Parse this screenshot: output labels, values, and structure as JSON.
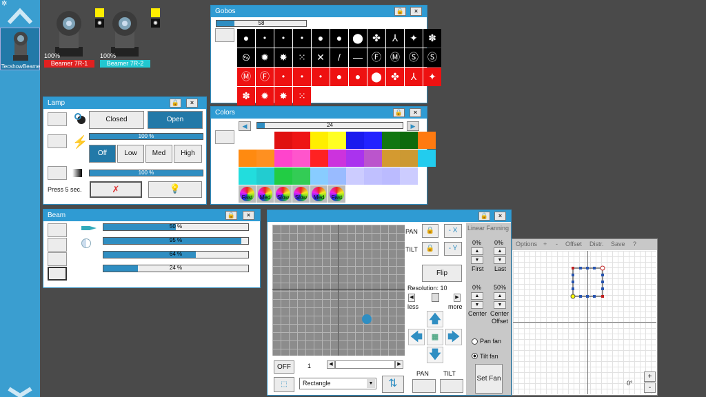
{
  "sidebar": {
    "fixture_label": "TecshowBeame"
  },
  "fixtures": [
    {
      "name": "Beamer 7R-1",
      "intensity": "100%",
      "color": "#e02020"
    },
    {
      "name": "Beamer 7R-2",
      "intensity": "100%",
      "color": "#22c7d0"
    }
  ],
  "gobos": {
    "title": "Gobos",
    "value": "58",
    "level": 0.2
  },
  "lamp": {
    "title": "Lamp",
    "closed": "Closed",
    "open": "Open",
    "lamp_level": "100 %",
    "dimmer_level": "100 %",
    "off": "Off",
    "low": "Low",
    "med": "Med",
    "high": "High",
    "press": "Press 5 sec."
  },
  "colors": {
    "title": "Colors",
    "value": "24",
    "level": 0.05,
    "speeds": [
      "Fast",
      "Med",
      "Slow",
      "Slow",
      "Med",
      "Fast"
    ]
  },
  "beam": {
    "title": "Beam",
    "bars": [
      {
        "label": "50 %",
        "level": 0.5
      },
      {
        "label": "95 %",
        "level": 0.95
      },
      {
        "label": "64 %",
        "level": 0.64
      },
      {
        "label": "24 %",
        "level": 0.24
      }
    ]
  },
  "pantilt": {
    "pan": "PAN",
    "tilt": "TILT",
    "neg_x": "- X",
    "neg_y": "- Y",
    "flip": "Flip",
    "resolution": "Resolution: 10",
    "less": "less",
    "more": "more",
    "off": "OFF",
    "step": "1",
    "shape": "Rectangle",
    "pan_bottom": "PAN",
    "tilt_bottom": "TILT"
  },
  "fanning": {
    "title": "Linear Fanning",
    "first_val": "0%",
    "last_val": "0%",
    "first": "First",
    "last": "Last",
    "center_val": "0%",
    "offset_val": "50%",
    "center": "Center",
    "center_offset1": "Center",
    "center_offset2": "Offset",
    "pan_fan": "Pan fan",
    "tilt_fan": "Tilt fan",
    "set_fan": "Set Fan"
  },
  "shape": {
    "menu": [
      "Options",
      "+",
      "-",
      "Offset",
      "Distr.",
      "Save",
      "?"
    ],
    "angle": "0°",
    "plus": "+",
    "minus": "-"
  }
}
